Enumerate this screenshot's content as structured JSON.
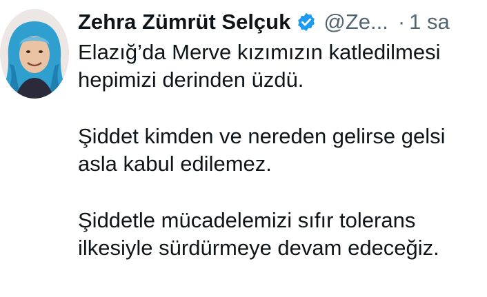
{
  "tweet": {
    "author_name": "Zehra Zümrüt Selçuk",
    "handle": "@Ze...",
    "separator": "·",
    "time": "1 sa",
    "verified": true,
    "paragraphs": [
      [
        "Elazığ’da Merve kızımızın katledilmesi",
        "hepimizi derinden üzdü."
      ],
      [
        "Şiddet kimden ve nereden gelirse gelsi",
        "asla kabul edilemez."
      ],
      [
        "Şiddetle mücadelemizi sıfır tolerans",
        "ilkesiyle sürdürmeye devam edeceğiz."
      ]
    ]
  },
  "colors": {
    "text": "#0f1419",
    "secondary_text": "#536471",
    "verified_badge": "#1d9bf0"
  },
  "icons": {
    "avatar": "profile-photo-woman-blue-headscarf",
    "verified": "verified-check-badge-icon"
  }
}
